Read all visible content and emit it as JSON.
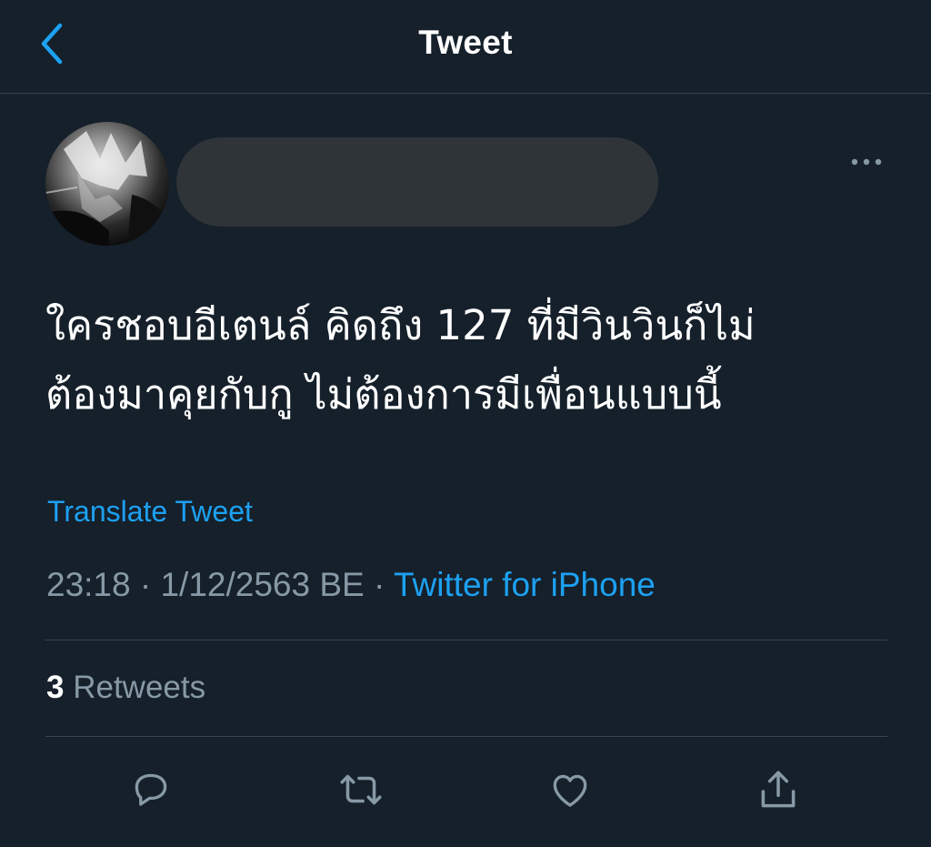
{
  "header": {
    "title": "Tweet",
    "back_icon": "chevron-left-icon"
  },
  "tweet": {
    "author_avatar_icon": "avatar-image",
    "more_icon": "more-horizontal-icon",
    "text_lines": [
      "ใครชอบอีเตนล์ คิดถึง 127 ที่มีวินวินก็ไม่",
      "ต้องมาคุยกับกู ไม่ต้องการมีเพื่อนแบบนี้"
    ],
    "translate_label": "Translate Tweet",
    "time": "23:18",
    "separator1": " · ",
    "date": "1/12/2563 BE",
    "separator2": " · ",
    "source": "Twitter for iPhone",
    "retweet_count": "3",
    "retweet_label": "Retweets"
  },
  "actions": {
    "reply_icon": "reply-icon",
    "retweet_icon": "retweet-icon",
    "like_icon": "heart-icon",
    "share_icon": "share-icon"
  },
  "colors": {
    "background": "#15202b",
    "accent": "#1da1f2",
    "secondary_text": "#8899a6",
    "divider": "#38444d"
  }
}
